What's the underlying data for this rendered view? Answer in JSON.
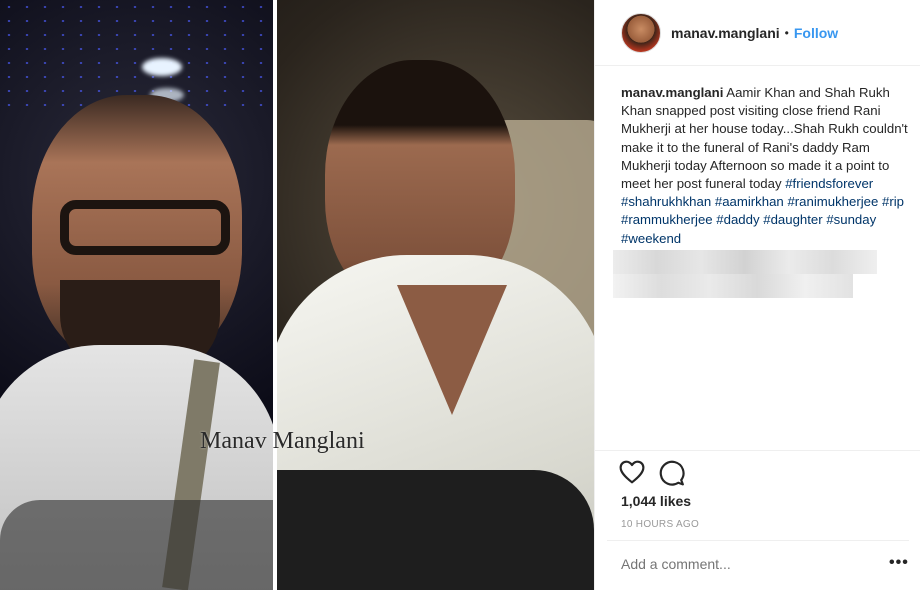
{
  "photo": {
    "watermark": "Manav Manglani"
  },
  "header": {
    "username": "manav.manglani",
    "separator": "•",
    "follow_label": "Follow"
  },
  "caption": {
    "username": "manav.manglani",
    "text": "Aamir Khan and Shah Rukh Khan snapped post visiting close friend Rani Mukherji at her house today...Shah Rukh couldn't make it to the funeral of Rani's daddy Ram Mukherji today Afternoon so made it a point to meet her post funeral today",
    "hashtags": [
      "#friendsforever",
      "#shahrukhkhan",
      "#aamirkhan",
      "#ranimukherjee",
      "#rip",
      "#rammukherjee",
      "#daddy",
      "#daughter",
      "#sunday",
      "#weekend"
    ]
  },
  "actions": {
    "like_icon": "heart-outline-icon",
    "comment_icon": "comment-bubble-icon"
  },
  "likes": "1,044 likes",
  "timestamp": "10 HOURS AGO",
  "comment": {
    "placeholder": "Add a comment...",
    "more_label": "•••"
  },
  "colors": {
    "link_blue": "#3897f0",
    "hashtag": "#003569",
    "text": "#262626",
    "muted": "#999999"
  }
}
